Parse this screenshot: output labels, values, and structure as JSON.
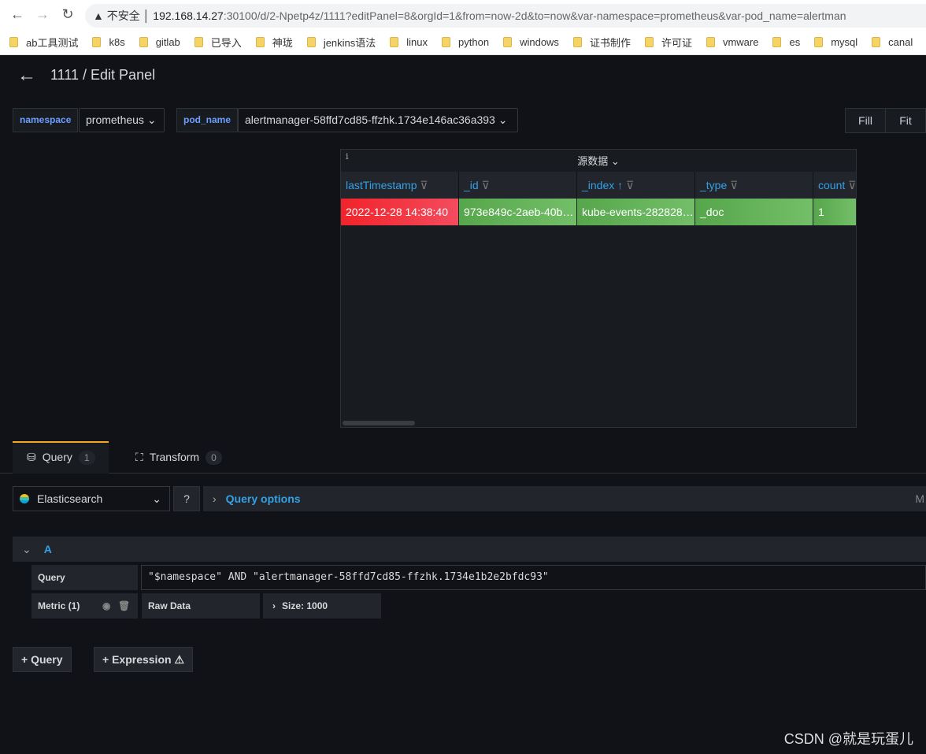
{
  "browser": {
    "security": "不安全",
    "url_host": "192.168.14.27",
    "url_rest": ":30100/d/2-Npetp4z/1111?editPanel=8&orgId=1&from=now-2d&to=now&var-namespace=prometheus&var-pod_name=alertman",
    "bookmarks": [
      "ab工具测试",
      "k8s",
      "gitlab",
      "已导入",
      "神珑",
      "jenkins语法",
      "linux",
      "python",
      "windows",
      "证书制作",
      "许可证",
      "vmware",
      "es",
      "mysql",
      "canal"
    ]
  },
  "header": {
    "title": "1111 / Edit Panel"
  },
  "variables": [
    {
      "label": "namespace",
      "value": "prometheus"
    },
    {
      "label": "pod_name",
      "value": "alertmanager-58ffd7cd85-ffzhk.1734e146ac36a393"
    }
  ],
  "view": {
    "fill": "Fill",
    "fit": "Fit"
  },
  "panel": {
    "title": "源数据",
    "columns": [
      "lastTimestamp",
      "_id",
      "_index",
      "_type",
      "count"
    ],
    "rows": [
      [
        "2022-12-28 14:38:40",
        "973e849c-2aeb-40b…",
        "kube-events-282828…",
        "_doc",
        "1"
      ]
    ],
    "colors": {
      "red": "#f2232a",
      "green": "#56a64b",
      "header": "#33a2e5"
    }
  },
  "tabs": [
    {
      "label": "Query",
      "count": "1"
    },
    {
      "label": "Transform",
      "count": "0"
    }
  ],
  "editor": {
    "datasource": "Elasticsearch",
    "query_options": "Query options",
    "query_ref": "A",
    "query_label": "Query",
    "query_value": "\"$namespace\" AND \"alertmanager-58ffd7cd85-ffzhk.1734e1b2e2bfdc93\"",
    "metric": "Metric (1)",
    "metric_type": "Raw Data",
    "size": "Size: 1000",
    "right_cut": "M",
    "add_query": "Query",
    "add_expression": "Expression"
  },
  "watermark": "CSDN @就是玩蛋儿"
}
